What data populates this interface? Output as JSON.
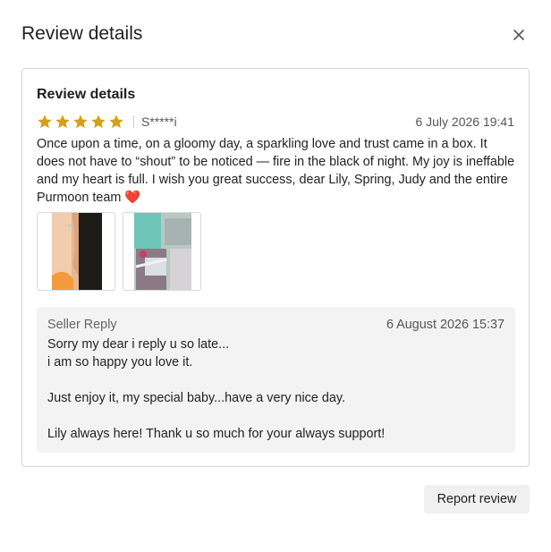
{
  "modal": {
    "title": "Review details",
    "close_icon": "close-icon"
  },
  "review": {
    "heading": "Review details",
    "rating": 5,
    "rating_max": 5,
    "star_color": "#d4a017",
    "reviewer": "S*****i",
    "date": "6 July 2026 19:41",
    "text": "Once upon a time, on a gloomy day, a sparkling love and trust came in a box. It does not have to “shout” to be noticed — fire in the black of night. My joy is ineffable and my heart is full. I wish you great success, dear Lily, Spring, Judy and the entire Purmoon team",
    "text_emoji": "heart-emoji",
    "photos": [
      {
        "name": "review-photo-earring"
      },
      {
        "name": "review-photo-package"
      }
    ]
  },
  "seller_reply": {
    "label": "Seller Reply",
    "date": "6 August 2026 15:37",
    "lines": [
      "Sorry my dear i reply u so late...",
      "i am so happy you love it.",
      "",
      "Just enjoy it, my special baby...have a very nice day.",
      "",
      "Lily always here! Thank u so much for your always support!"
    ]
  },
  "actions": {
    "report_label": "Report review"
  }
}
